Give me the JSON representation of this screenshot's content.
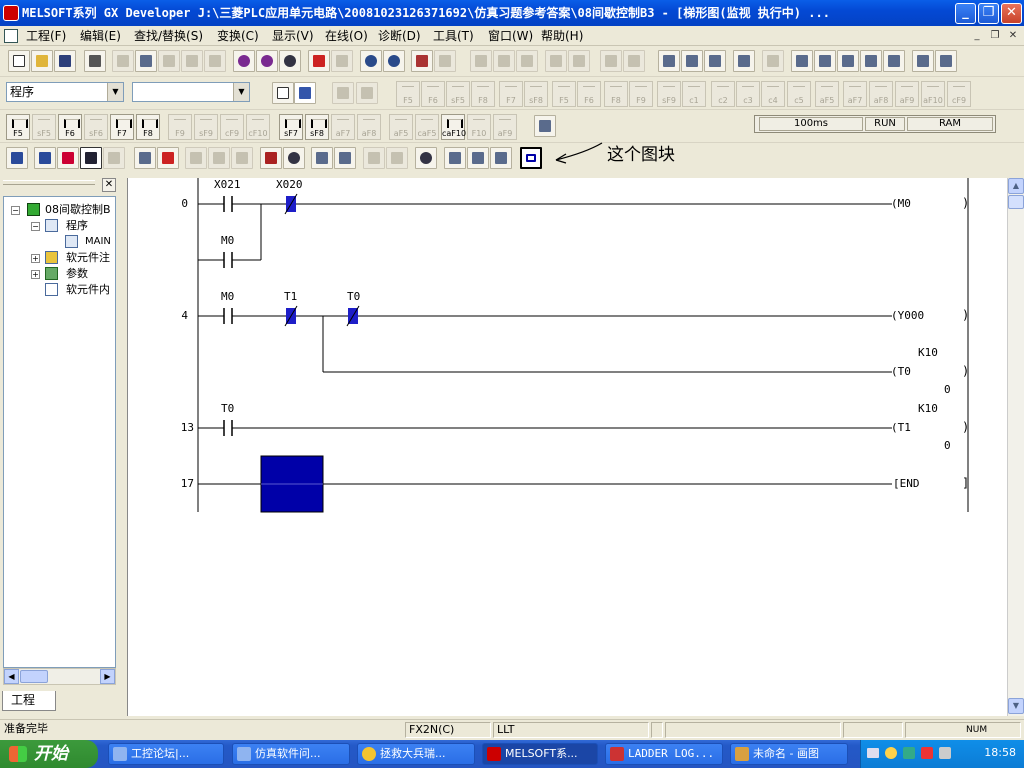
{
  "window": {
    "title": "MELSOFT系列 GX Developer J:\\三菱PLC应用单元电路\\20081023126371692\\仿真习题参考答案\\08间歇控制B3 - [梯形图(监视 执行中)   ..."
  },
  "menus": [
    "工程(F)",
    "编辑(E)",
    "查找/替换(S)",
    "变换(C)",
    "显示(V)",
    "在线(O)",
    "诊断(D)",
    "工具(T)",
    "窗口(W)",
    "帮助(H)"
  ],
  "toolbar2": {
    "combo1": "程序",
    "combo2": ""
  },
  "fkeys_row2": [
    "F5",
    "F6",
    "sF5",
    "F8",
    "F7",
    "sF8",
    "F5",
    "F6",
    "F8",
    "F9",
    "sF9",
    "c1",
    "c2",
    "c3",
    "c4",
    "c5",
    "aF5",
    "aF7",
    "aF8",
    "aF9",
    "aF10",
    "cF9"
  ],
  "fkeys_row3": [
    "F5",
    "sF5",
    "F6",
    "sF6",
    "F7",
    "F8",
    "F9",
    "sF9",
    "cF9",
    "cF10",
    "sF7",
    "sF8",
    "aF7",
    "aF8",
    "aF5",
    "caF5",
    "caF10",
    "F10",
    "aF9"
  ],
  "plc_status": {
    "scan": "100ms",
    "mode": "RUN",
    "mem": "RAM"
  },
  "annotation": "这个图块",
  "tree": {
    "root": "08间歇控制B",
    "program": "程序",
    "main": "MAIN",
    "comments": "软元件注",
    "params": "参数",
    "memory": "软元件内"
  },
  "project_tab": "工程",
  "ladder": {
    "rungs": [
      {
        "step": "0",
        "contacts": [
          "X021",
          "X020",
          "M0"
        ],
        "coil": "(M0"
      },
      {
        "step": "4",
        "contacts": [
          "M0",
          "T1",
          "T0"
        ],
        "coil": "(Y000",
        "timer_coil": "(T0",
        "timer_k": "K10",
        "timer_val": "0"
      },
      {
        "step": "13",
        "contacts": [
          "T0"
        ],
        "coil": "(T1",
        "timer_k": "K10",
        "timer_val": "0"
      },
      {
        "step": "17",
        "coil": "[END"
      }
    ]
  },
  "statusbar": {
    "ready": "准备完毕",
    "plc": "FX2N(C)",
    "mode": "LLT",
    "num": "NUM"
  },
  "taskbar": {
    "start": "开始",
    "tasks": [
      "工控论坛|...",
      "仿真软件问...",
      "拯救大兵瑞...",
      "MELSOFT系...",
      "LADDER LOG...",
      "未命名 - 画图"
    ],
    "clock": "18:58"
  },
  "colors": {
    "highlight": "#0000a8",
    "contact_on": "#1e1ec8",
    "titlebar": "#0449d4"
  }
}
